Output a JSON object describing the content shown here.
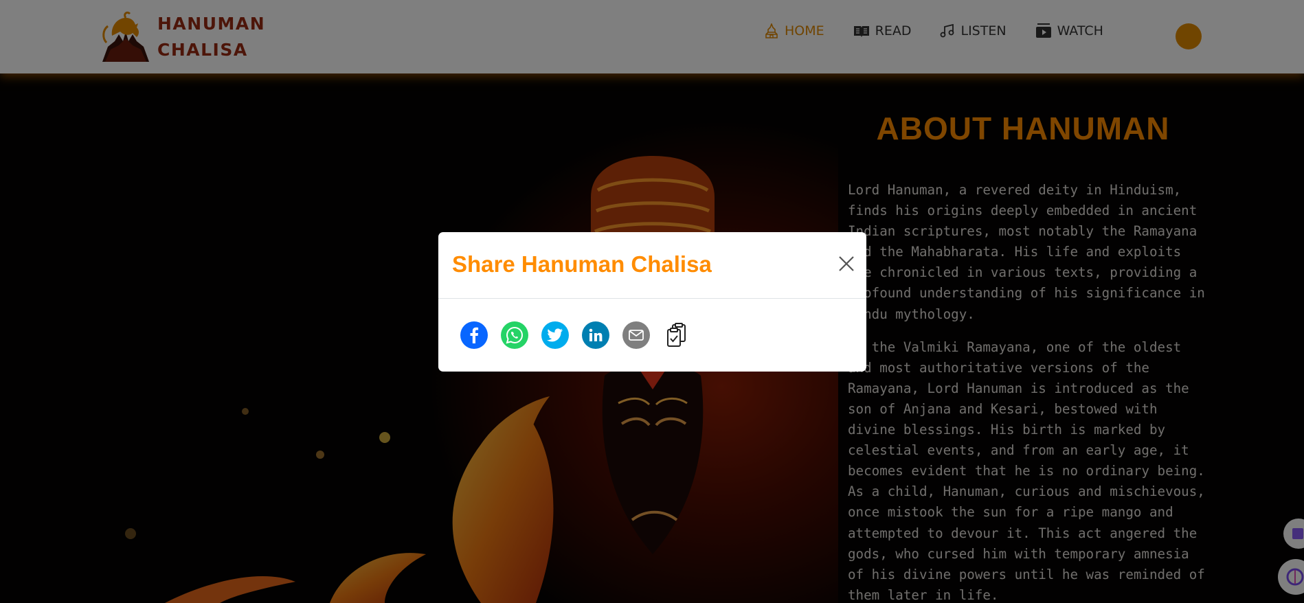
{
  "header": {
    "logo_line1": "HANUMAN",
    "logo_line2": "CHALISA",
    "nav": [
      {
        "label": "HOME",
        "icon": "temple-icon",
        "active": true
      },
      {
        "label": "READ",
        "icon": "book-icon",
        "active": false
      },
      {
        "label": "LISTEN",
        "icon": "music-icon",
        "active": false
      },
      {
        "label": "WATCH",
        "icon": "video-icon",
        "active": false
      }
    ]
  },
  "about": {
    "title": "ABOUT HANUMAN",
    "paragraph1": "Lord Hanuman, a revered deity in Hinduism, finds his origins deeply embedded in ancient Indian scriptures, most notably the Ramayana and the Mahabharata. His life and exploits are chronicled in various texts, providing a profound understanding of his significance in Hindu mythology.",
    "paragraph2": "In the Valmiki Ramayana, one of the oldest and most authoritative versions of the Ramayana, Lord Hanuman is introduced as the son of Anjana and Kesari, bestowed with divine blessings. His birth is marked by celestial events, and from an early age, it becomes evident that he is no ordinary being. As a child, Hanuman, curious and mischievous, once mistook the sun for a ripe mango and attempted to devour it. This act angered the gods, who cursed him with temporary amnesia of his divine powers until he was reminded of them later in life."
  },
  "modal": {
    "title": "Share Hanuman Chalisa",
    "share_options": [
      "facebook-icon",
      "whatsapp-icon",
      "twitter-icon",
      "linkedin-icon",
      "email-icon",
      "copy-link-icon"
    ]
  },
  "colors": {
    "accent": "#ff8c00",
    "logo": "#9a2a12",
    "facebook": "#0866ff",
    "whatsapp": "#25d366",
    "twitter": "#00aced",
    "linkedin": "#007fb1",
    "email": "#7f7f7f"
  }
}
